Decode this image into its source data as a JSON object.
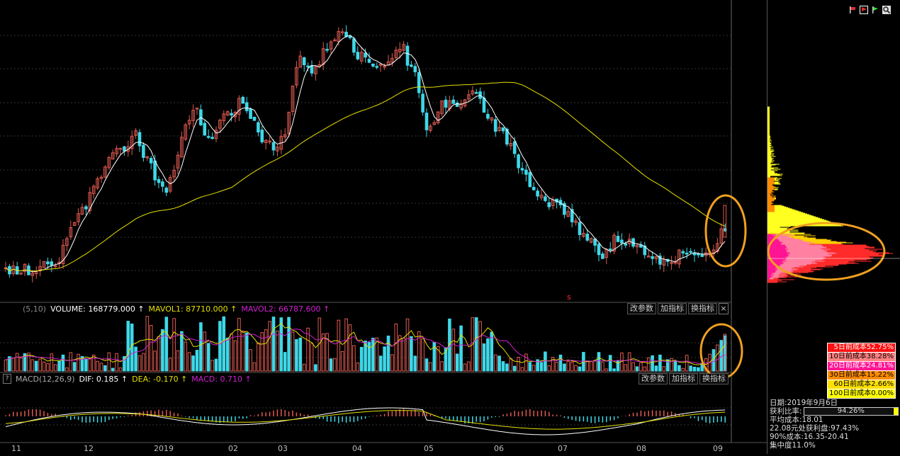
{
  "volume_bar": {
    "prefix": "(5,10)",
    "volume": "VOLUME: 168779.000 ↑",
    "mavol1": "MAVOL1: 87710.000 ↑",
    "mavol2": "MAVOL2: 66787.600 ↑",
    "btn_params": "改参数",
    "btn_add": "加指标",
    "btn_switch": "换指标",
    "close": "×"
  },
  "macd_bar": {
    "help": "?",
    "title": "MACD(12,26,9)",
    "dif": "DIF: 0.185 ↑",
    "dea": "DEA: -0.170 ↑",
    "macd": "MACD: 0.710 ↑",
    "btn_params": "改参数",
    "btn_add": "加指标",
    "btn_switch": "换指标"
  },
  "x_axis": [
    "11",
    "12",
    "2019",
    "02",
    "03",
    "04",
    "05",
    "06",
    "07",
    "08",
    "09"
  ],
  "marker": "s",
  "colors": {
    "up": "#e05a50",
    "down": "#3fd8e8",
    "ma_short": "#ffffff",
    "ma_long": "#e6e000",
    "mavol2": "#d020d0",
    "highlight": "#f0a020"
  },
  "legend": [
    {
      "label": "5日前成本52.75%",
      "bg": "#ff1010",
      "fg": "#ffffff"
    },
    {
      "label": "10日前成本38.28%",
      "bg": "#ff8080",
      "fg": "#000000"
    },
    {
      "label": "20日前成本24.81%",
      "bg": "#ff1493",
      "fg": "#ffffff"
    },
    {
      "label": "30日前成本15.22%",
      "bg": "#ff8c00",
      "fg": "#000000"
    },
    {
      "label": "60日前成本2.66%",
      "bg": "#ffe000",
      "fg": "#000000"
    },
    {
      "label": "100日前成本0.00%",
      "bg": "#ffff00",
      "fg": "#000000"
    }
  ],
  "info": {
    "date": "日期:2019年9月6日",
    "profit_label": "获利比率:",
    "profit_value": "94.26%",
    "profit_ratio": 0.9426,
    "avg_cost": "平均成本:18.01",
    "profit_at": "22.08元处获利盘:97.43%",
    "cost90": "90%成本:16.35-20.41",
    "concentration": "集中度11.0%"
  },
  "toolbar_icons": [
    "flag-icon",
    "red-flag-icon",
    "green-flag-icon",
    "search-icon"
  ]
}
